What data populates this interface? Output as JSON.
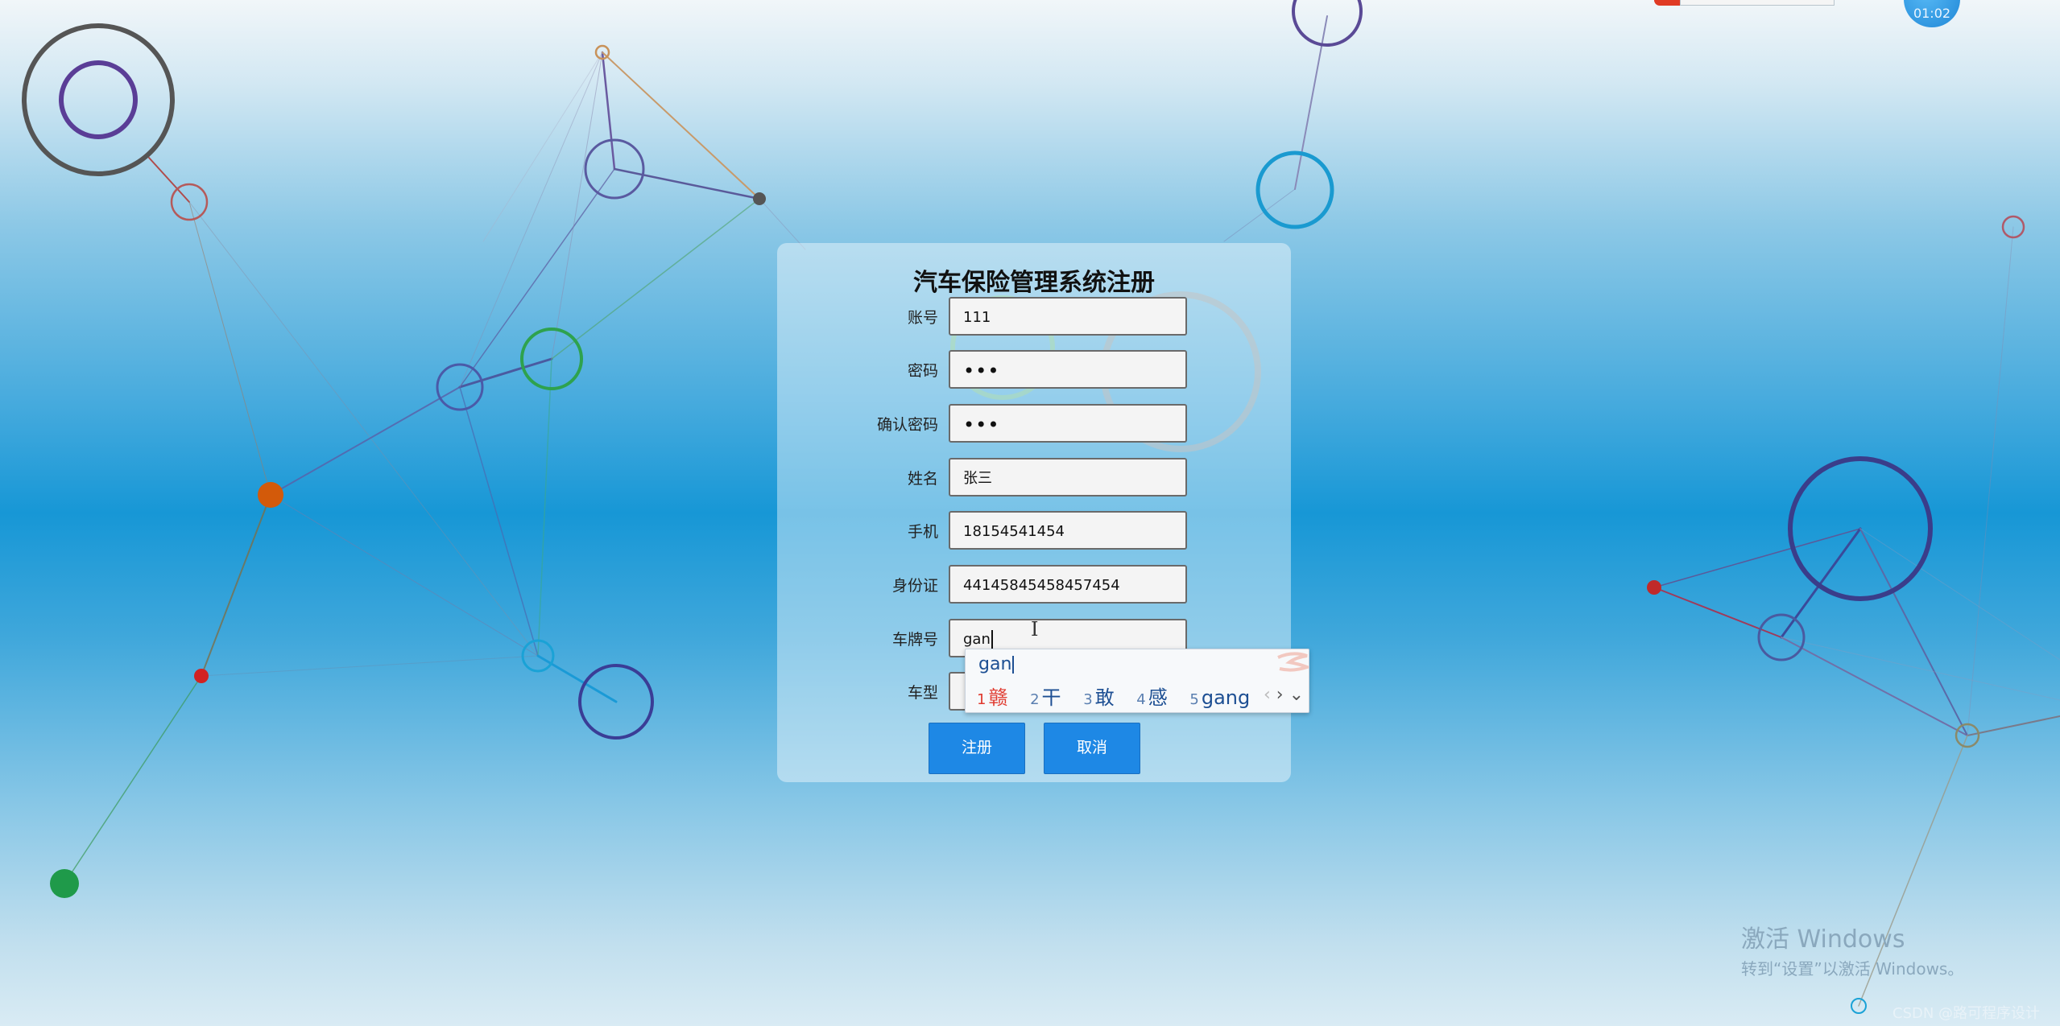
{
  "form": {
    "title": "汽车保险管理系统注册",
    "fields": [
      {
        "label": "账号",
        "value": "111"
      },
      {
        "label": "密码",
        "value": "•••"
      },
      {
        "label": "确认密码",
        "value": "•••"
      },
      {
        "label": "姓名",
        "value": "张三"
      },
      {
        "label": "手机",
        "value": "18154541454"
      },
      {
        "label": "身份证",
        "value": "44145845458457454"
      },
      {
        "label": "车牌号",
        "value": "gan"
      },
      {
        "label": "车型",
        "value": ""
      }
    ],
    "register_label": "注册",
    "cancel_label": "取消"
  },
  "ime": {
    "composition": "gan",
    "candidates": [
      {
        "num": "1",
        "text": "赣"
      },
      {
        "num": "2",
        "text": "干"
      },
      {
        "num": "3",
        "text": "敢"
      },
      {
        "num": "4",
        "text": "感"
      },
      {
        "num": "5",
        "text": "gang"
      }
    ],
    "prev_icon": "‹",
    "next_icon": "›",
    "expand_icon": "⌄"
  },
  "clock": {
    "time": "01:02"
  },
  "watermark": {
    "line1": "激活 Windows",
    "line2": "转到“设置”以激活 Windows。"
  },
  "credit": "CSDN @路可程序设计"
}
